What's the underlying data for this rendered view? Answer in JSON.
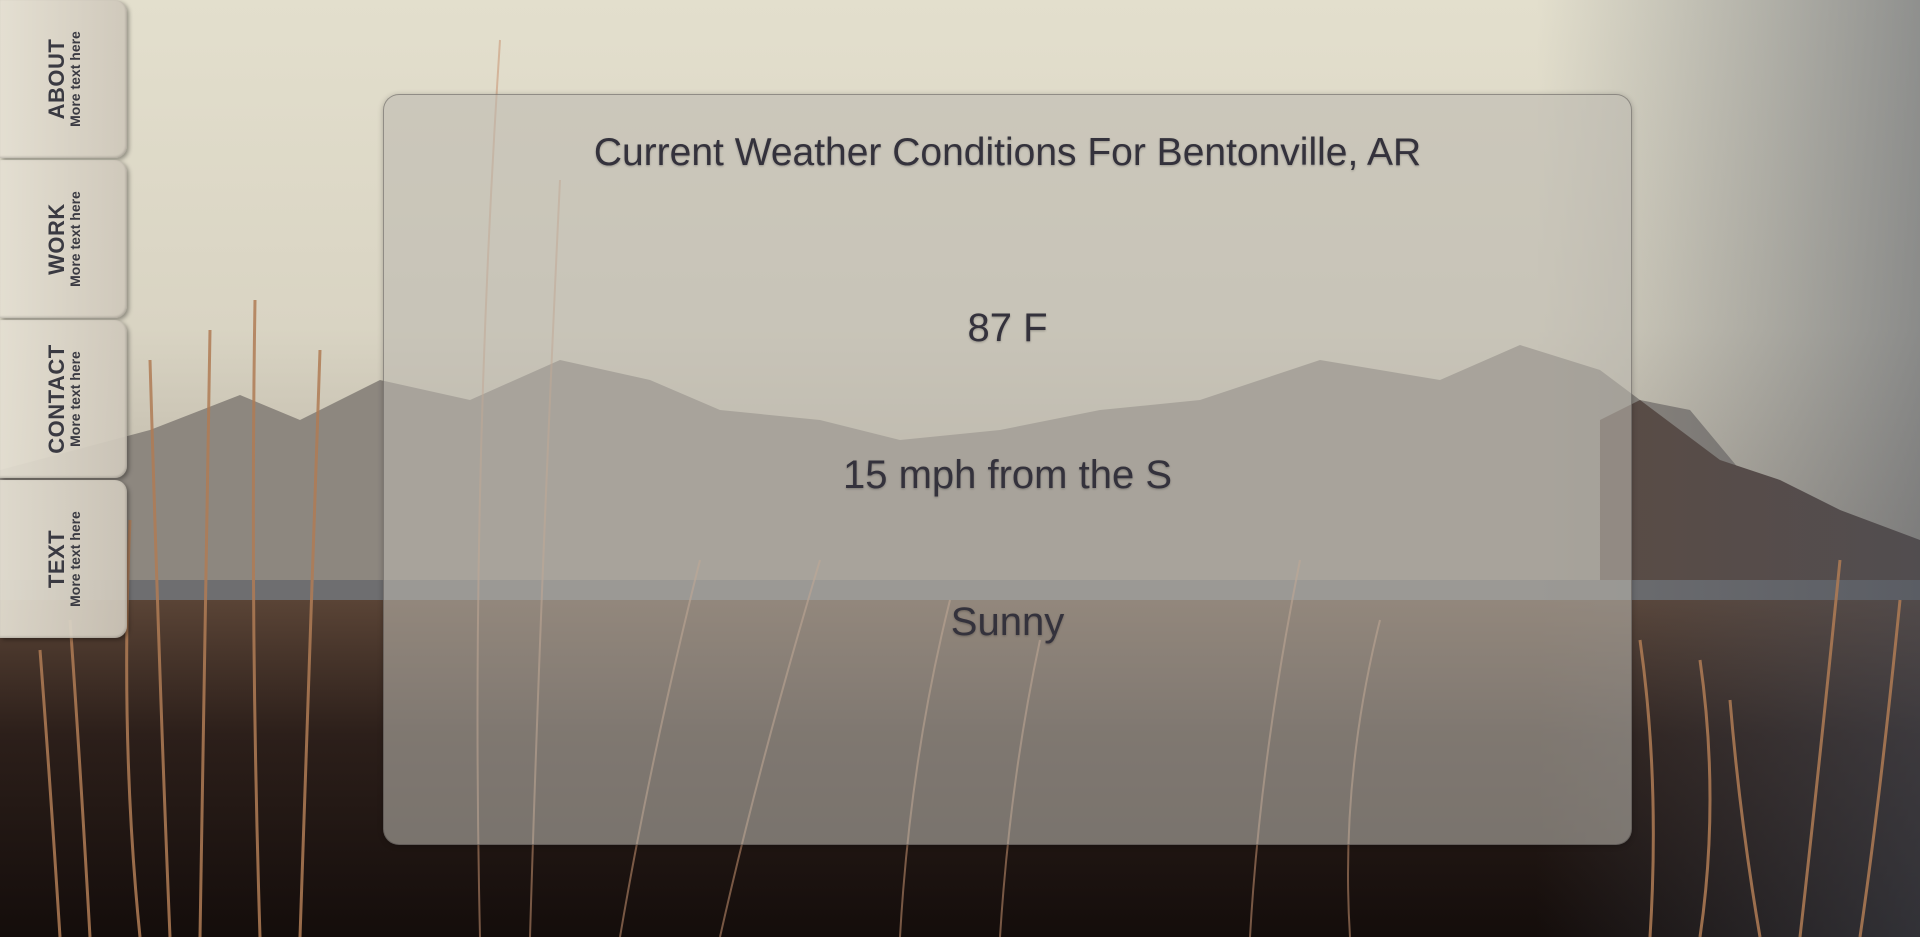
{
  "nav": {
    "tabs": [
      {
        "title": "ABOUT",
        "subtitle": "More text here"
      },
      {
        "title": "WORK",
        "subtitle": "More text here"
      },
      {
        "title": "CONTACT",
        "subtitle": "More text here"
      },
      {
        "title": "TEXT",
        "subtitle": "More text here"
      }
    ]
  },
  "weather": {
    "title": "Current Weather Conditions For Bentonville, AR",
    "temperature": "87 F",
    "wind": "15 mph from the S",
    "condition": "Sunny"
  }
}
